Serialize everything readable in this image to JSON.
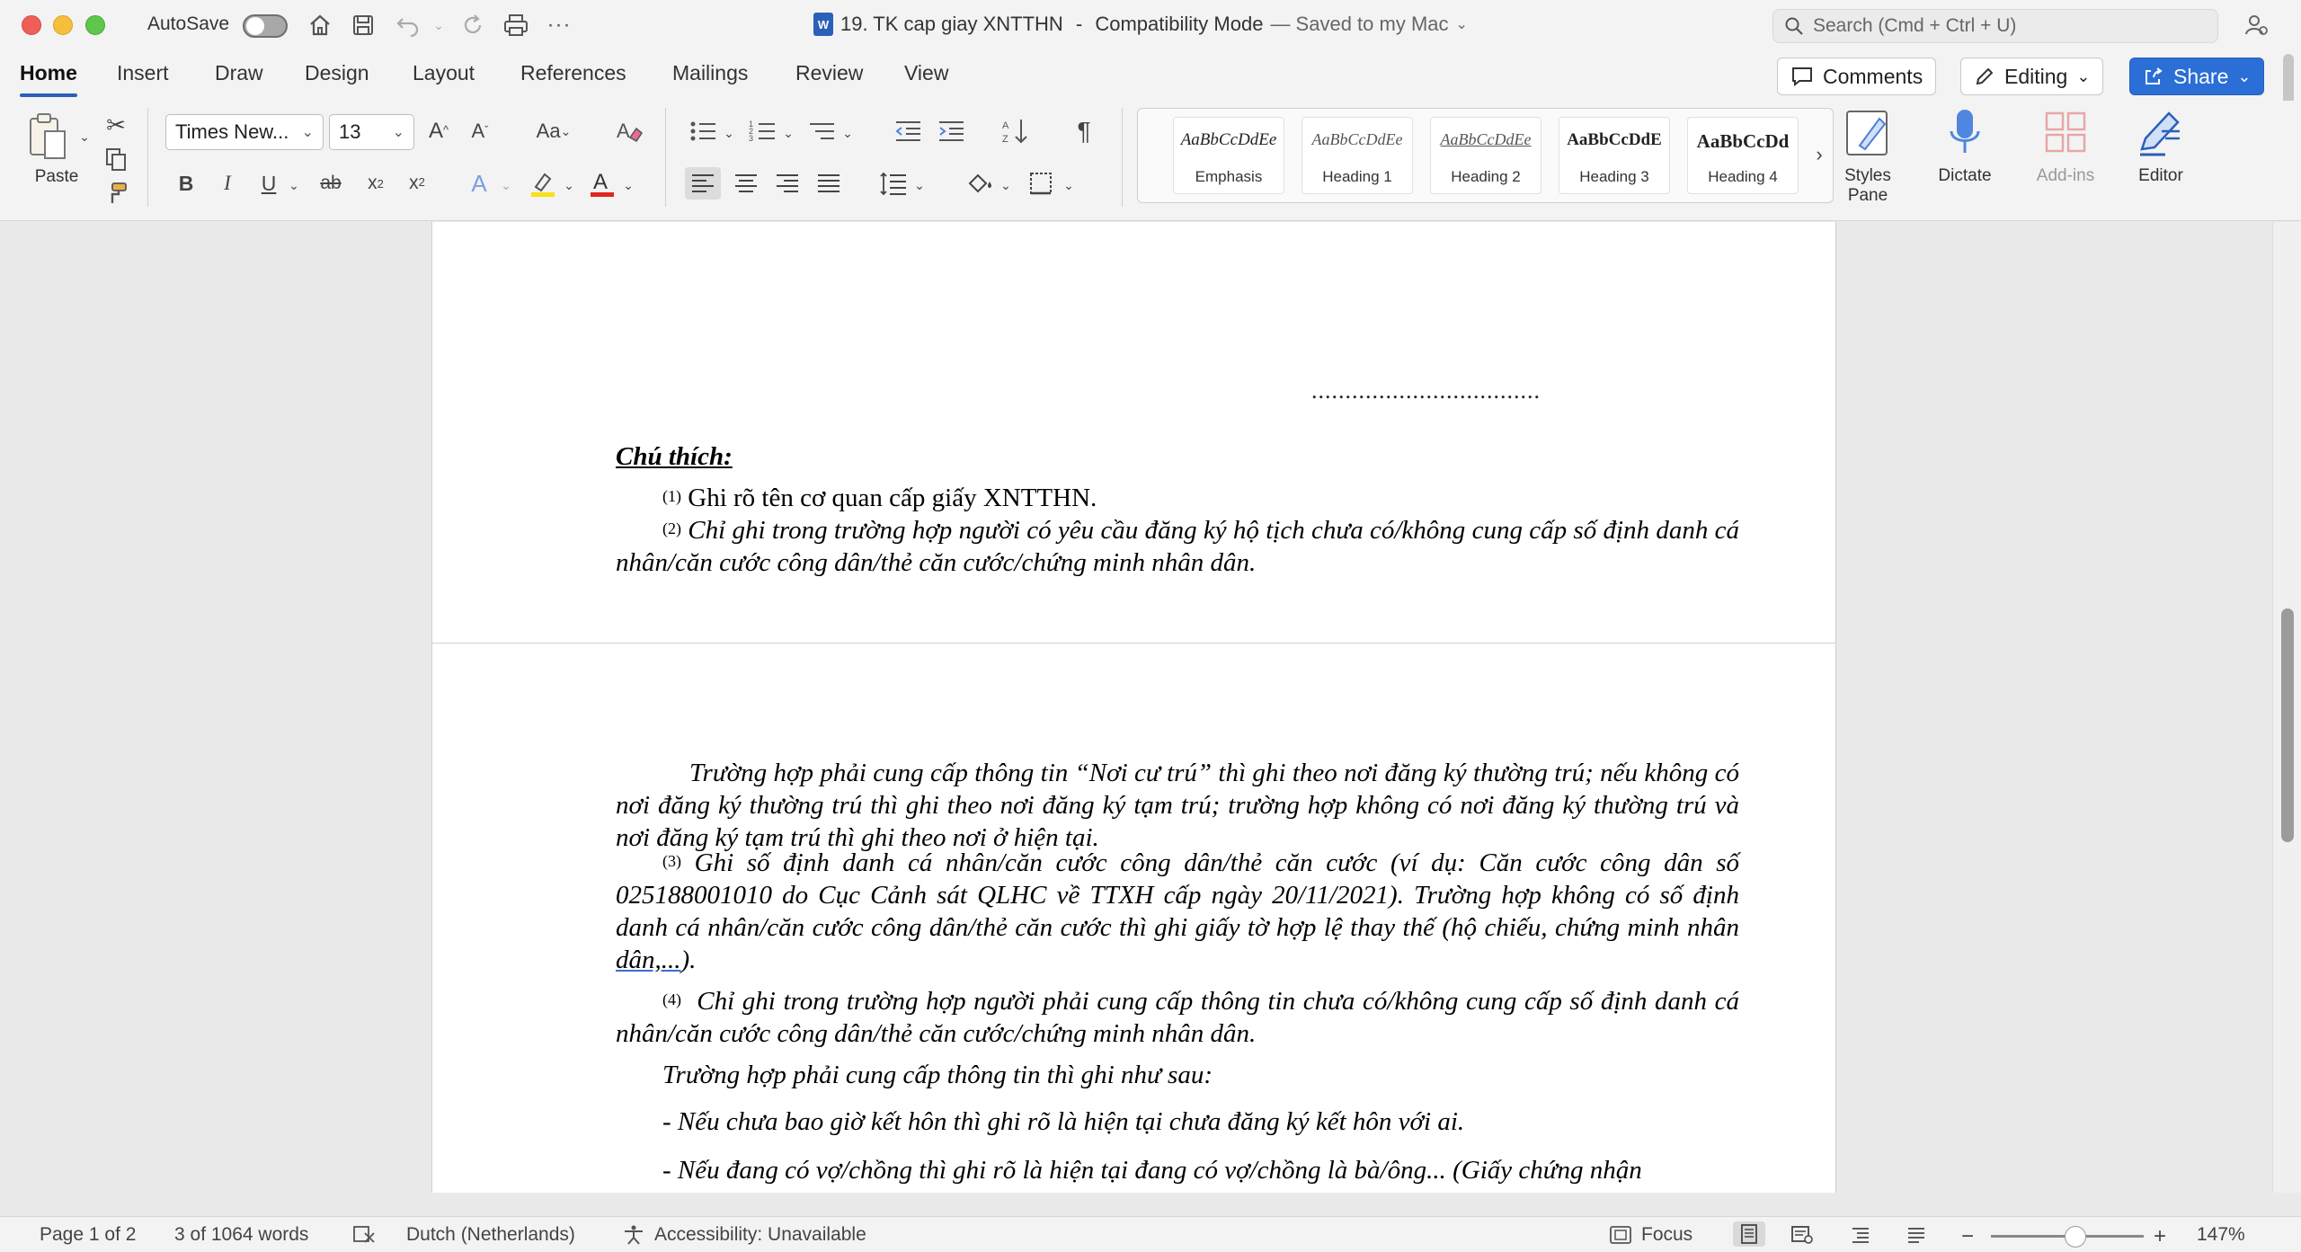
{
  "titlebar": {
    "autosave_label": "AutoSave",
    "doc_title": "19. TK cap giay XNTTHN",
    "doc_mode": "Compatibility Mode",
    "save_status": "— Saved to my Mac",
    "search_placeholder": "Search (Cmd + Ctrl + U)",
    "icons": [
      "home-icon",
      "save-icon",
      "undo-icon",
      "redo-icon",
      "print-icon",
      "more-icon",
      "account-icon"
    ]
  },
  "tabs": [
    {
      "label": "Home",
      "active": true
    },
    {
      "label": "Insert"
    },
    {
      "label": "Draw"
    },
    {
      "label": "Design"
    },
    {
      "label": "Layout"
    },
    {
      "label": "References"
    },
    {
      "label": "Mailings"
    },
    {
      "label": "Review"
    },
    {
      "label": "View"
    }
  ],
  "actions": {
    "comments": "Comments",
    "editing": "Editing",
    "share": "Share"
  },
  "ribbon": {
    "paste_label": "Paste",
    "font_name": "Times New...",
    "font_size": "13",
    "styles": [
      {
        "sample": "AaBbCcDdEe",
        "name": "Emphasis"
      },
      {
        "sample": "AaBbCcDdEe",
        "name": "Heading 1"
      },
      {
        "sample": "AaBbCcDdEe",
        "name": "Heading 2"
      },
      {
        "sample": "AaBbCcDdE",
        "name": "Heading 3"
      },
      {
        "sample": "AaBbCcDd",
        "name": "Heading 4"
      }
    ],
    "styles_pane_label": "Styles\nPane",
    "styles_pane_line1": "Styles",
    "styles_pane_line2": "Pane",
    "dictate_label": "Dictate",
    "addins_label": "Add-ins",
    "editor_label": "Editor"
  },
  "document": {
    "page1": {
      "dots": "..................................",
      "note_heading": "Chú thích:",
      "note1_sup": "(1)",
      "note1": "Ghi rõ tên cơ quan cấp giấy XNTTHN.",
      "note2_sup": "(2)",
      "note2": "Chỉ ghi trong trường hợp người có yêu cầu đăng ký hộ tịch chưa có/không cung cấp số định danh cá nhân/căn cước công dân/thẻ căn cước/chứng minh nhân dân."
    },
    "page2": {
      "para1": "Trường hợp phải cung cấp thông tin “Nơi cư trú” thì ghi theo nơi đăng ký thường trú; nếu không có nơi đăng ký thường trú thì ghi theo nơi đăng ký tạm trú; trường hợp không có nơi đăng ký thường trú và nơi đăng ký tạm trú thì ghi theo nơi ở hiện tại.",
      "note3_sup": "(3)",
      "note3": "Ghi số định danh cá nhân/căn cước công dân/thẻ căn cước (ví dụ: Căn cước công dân số 025188001010 do Cục Cảnh sát QLHC về TTXH cấp ngày 20/11/2021). Trường hợp không có số định danh cá nhân/căn cước công dân/thẻ căn cước thì ghi giấy tờ hợp lệ thay thế (hộ chiếu, chứng minh nhân ",
      "note3_tail": "dân,...",
      "note3_end": ").",
      "note4_sup": "(4)",
      "note4": "Chỉ ghi trong trường hợp người phải cung cấp thông tin chưa có/không cung cấp số định danh cá nhân/căn cước công dân/thẻ căn cước/chứng minh nhân dân.",
      "para5": "Trường hợp phải cung cấp thông tin thì ghi như sau:",
      "bullet1": "- Nếu chưa bao giờ kết hôn thì ghi rõ là hiện tại chưa đăng ký kết hôn với ai.",
      "bullet2": "- Nếu đang có vợ/chồng thì ghi rõ là hiện tại đang có vợ/chồng là bà/ông... (Giấy chứng nhận"
    }
  },
  "statusbar": {
    "page": "Page 1 of 2",
    "words": "3 of 1064 words",
    "language": "Dutch (Netherlands)",
    "accessibility": "Accessibility: Unavailable",
    "focus": "Focus",
    "zoom": "147%",
    "zoom_level": 0.55
  }
}
